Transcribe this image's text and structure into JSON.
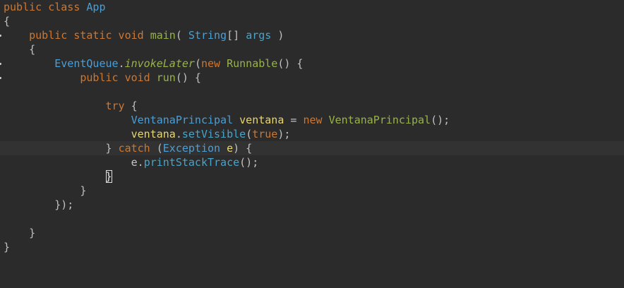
{
  "editor": {
    "lines": [
      [
        {
          "t": "public class ",
          "c": "kw"
        },
        {
          "t": "App",
          "c": "cls"
        }
      ],
      [
        {
          "t": "{",
          "c": "punc"
        }
      ],
      [
        {
          "t": "    public static void ",
          "c": "kw"
        },
        {
          "t": "main",
          "c": "fn"
        },
        {
          "t": "( ",
          "c": "punc"
        },
        {
          "t": "String",
          "c": "cls"
        },
        {
          "t": "[] ",
          "c": "punc"
        },
        {
          "t": "args",
          "c": "member"
        },
        {
          "t": " )",
          "c": "punc"
        }
      ],
      [
        {
          "t": "    {",
          "c": "punc"
        }
      ],
      [
        {
          "t": "        ",
          "c": "plain"
        },
        {
          "t": "EventQueue",
          "c": "cls"
        },
        {
          "t": ".",
          "c": "punc"
        },
        {
          "t": "invokeLater",
          "c": "fni"
        },
        {
          "t": "(",
          "c": "punc"
        },
        {
          "t": "new ",
          "c": "kw"
        },
        {
          "t": "Runnable",
          "c": "fn"
        },
        {
          "t": "() {",
          "c": "punc"
        }
      ],
      [
        {
          "t": "            public void ",
          "c": "kw"
        },
        {
          "t": "run",
          "c": "fn"
        },
        {
          "t": "() {",
          "c": "punc"
        }
      ],
      [
        {
          "t": "",
          "c": "plain"
        }
      ],
      [
        {
          "t": "                try ",
          "c": "kw"
        },
        {
          "t": "{",
          "c": "punc"
        }
      ],
      [
        {
          "t": "                    ",
          "c": "plain"
        },
        {
          "t": "VentanaPrincipal ",
          "c": "cls"
        },
        {
          "t": "ventana",
          "c": "var"
        },
        {
          "t": " = ",
          "c": "punc"
        },
        {
          "t": "new ",
          "c": "kw"
        },
        {
          "t": "VentanaPrincipal",
          "c": "fn"
        },
        {
          "t": "();",
          "c": "punc"
        }
      ],
      [
        {
          "t": "                    ",
          "c": "plain"
        },
        {
          "t": "ventana",
          "c": "var"
        },
        {
          "t": ".",
          "c": "punc"
        },
        {
          "t": "setVisible",
          "c": "member"
        },
        {
          "t": "(",
          "c": "punc"
        },
        {
          "t": "true",
          "c": "kw"
        },
        {
          "t": ");",
          "c": "punc"
        }
      ],
      [
        {
          "t": "                } ",
          "c": "punc"
        },
        {
          "t": "catch ",
          "c": "kw"
        },
        {
          "t": "(",
          "c": "punc"
        },
        {
          "t": "Exception ",
          "c": "cls"
        },
        {
          "t": "e",
          "c": "var"
        },
        {
          "t": ") {",
          "c": "punc"
        }
      ],
      [
        {
          "t": "                    ",
          "c": "plain"
        },
        {
          "t": "e",
          "c": "plain"
        },
        {
          "t": ".",
          "c": "punc"
        },
        {
          "t": "printStackTrace",
          "c": "member"
        },
        {
          "t": "();",
          "c": "punc"
        }
      ],
      [
        {
          "t": "                ",
          "c": "plain"
        },
        {
          "t": "}",
          "c": "cursor"
        }
      ],
      [
        {
          "t": "            }",
          "c": "punc"
        }
      ],
      [
        {
          "t": "        });",
          "c": "punc"
        }
      ],
      [
        {
          "t": "",
          "c": "plain"
        }
      ],
      [
        {
          "t": "    }",
          "c": "punc"
        }
      ],
      [
        {
          "t": "}",
          "c": "punc"
        }
      ]
    ],
    "current_line": 10,
    "fold_markers": [
      2,
      4,
      5
    ]
  },
  "colors": {
    "background": "#2b2b2b",
    "current_line": "#323232",
    "keyword": "#cc7832",
    "class": "#4a9fd6",
    "function": "#98b34a",
    "variable": "#e8d670",
    "text": "#c0c0c0"
  }
}
